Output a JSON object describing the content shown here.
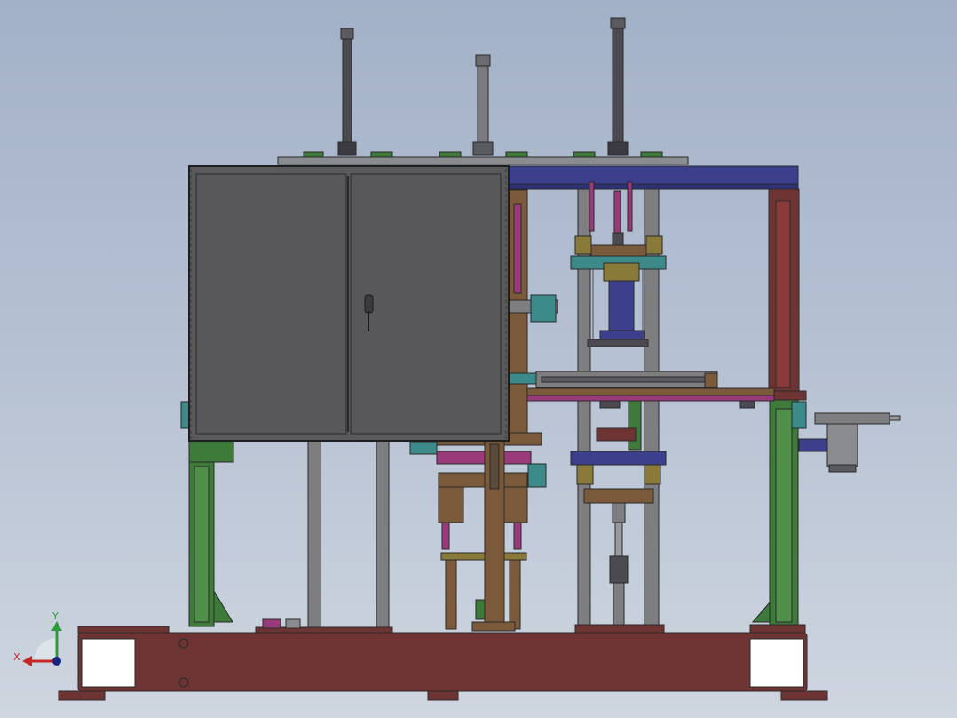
{
  "viewport": {
    "background_top": "#a3b1c8",
    "background_bottom": "#cfd6e0"
  },
  "model": {
    "colors": {
      "outline": "#2a2a2a",
      "base_frame": "#6e3434",
      "green_frame": "#3e7a3a",
      "blue_frame": "#3b3f8c",
      "cabinet": "#5a5a5c",
      "cabinet_panel": "#58585b",
      "brown": "#7a5a3a",
      "column_grey": "#7e7e80",
      "rod_dark": "#4a4a50",
      "magenta": "#9a3a7a",
      "teal": "#3c8a8a",
      "olive": "#8a7a3a"
    }
  },
  "triad": {
    "x_label": "X",
    "y_label": "Y",
    "x_color": "#c62828",
    "y_color": "#2e9b3a",
    "z_color": "#1a237e"
  }
}
